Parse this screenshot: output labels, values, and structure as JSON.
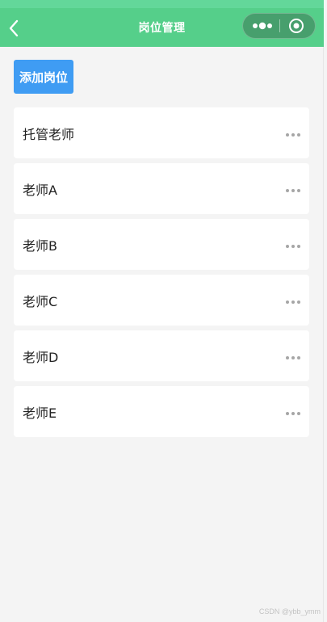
{
  "navbar": {
    "title": "岗位管理",
    "back_icon": "chevron-left-icon",
    "capsule": {
      "more_icon": "more-dots-icon",
      "close_icon": "target-circle-icon"
    },
    "color": "#55cf8a"
  },
  "toolbar": {
    "add_label": "添加岗位",
    "add_color": "#3f9cf3"
  },
  "positions": [
    {
      "label": "托管老师"
    },
    {
      "label": "老师A"
    },
    {
      "label": "老师B"
    },
    {
      "label": "老师C"
    },
    {
      "label": "老师D"
    },
    {
      "label": "老师E"
    }
  ],
  "watermark": "CSDN @ybb_ymm"
}
